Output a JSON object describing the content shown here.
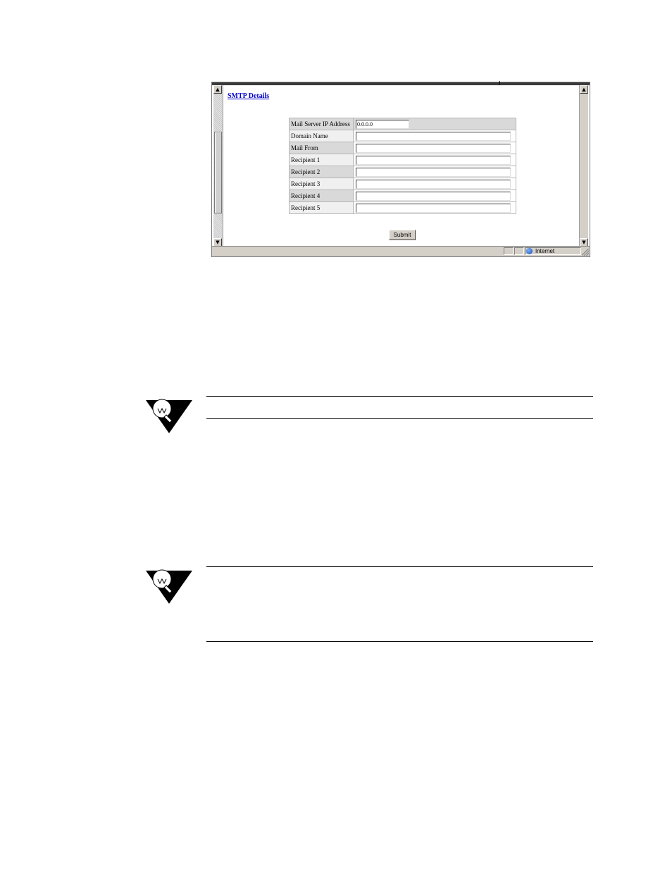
{
  "browser": {
    "page_title": "SMTP Details",
    "form": {
      "rows": [
        {
          "label": "Mail Server IP Address",
          "value": "0.0.0.0"
        },
        {
          "label": "Domain Name",
          "value": ""
        },
        {
          "label": "Mail From",
          "value": ""
        },
        {
          "label": "Recipient 1",
          "value": ""
        },
        {
          "label": "Recipient 2",
          "value": ""
        },
        {
          "label": "Recipient 3",
          "value": ""
        },
        {
          "label": "Recipient 4",
          "value": ""
        },
        {
          "label": "Recipient 5",
          "value": ""
        }
      ],
      "submit_label": "Submit"
    },
    "status_bar": {
      "zone_text": "Internet",
      "zone_icon": "globe-icon"
    },
    "scroll_icons": {
      "up": "▲",
      "down": "▼"
    }
  },
  "notes": [
    {
      "icon": "lightbulb-note-icon"
    },
    {
      "icon": "lightbulb-note-icon"
    }
  ]
}
